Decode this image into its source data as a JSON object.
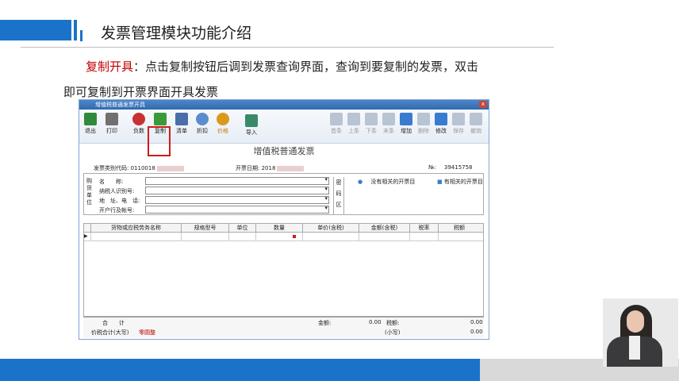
{
  "slide": {
    "title": "发票管理模块功能介绍",
    "highlight": "复制开具",
    "desc_part1": "：点击复制按钮后调到发票查询界面，查询到要复制的发票，双击",
    "desc_part2": "即可复制到开票界面开具发票"
  },
  "window": {
    "title": "增值税普通发票开具",
    "close_label": "x",
    "toolbar_left": [
      {
        "label": "退出",
        "icon": "exit-icon",
        "color": "#2f8b3a"
      },
      {
        "label": "打印",
        "icon": "printer-icon",
        "color": "#707070"
      },
      {
        "label": "负数",
        "icon": "negative-icon",
        "color": "#c93030"
      },
      {
        "label": "复制",
        "icon": "copy-icon",
        "color": "#3a9a3a"
      },
      {
        "label": "清单",
        "icon": "list-icon",
        "color": "#4a6fa8"
      },
      {
        "label": "折扣",
        "icon": "discount-icon",
        "color": "#5a8ccf"
      },
      {
        "label": "价格",
        "icon": "price-icon",
        "color": "#d99a1a"
      },
      {
        "label": "导入",
        "icon": "import-icon",
        "color": "#3a8a6a"
      }
    ],
    "toolbar_right": [
      {
        "label": "首条",
        "icon": "first-icon",
        "enabled": false
      },
      {
        "label": "上条",
        "icon": "prev-icon",
        "enabled": false
      },
      {
        "label": "下条",
        "icon": "next-icon",
        "enabled": false
      },
      {
        "label": "末条",
        "icon": "last-icon",
        "enabled": false
      },
      {
        "label": "增加",
        "icon": "add-icon",
        "enabled": true
      },
      {
        "label": "删除",
        "icon": "delete-icon",
        "enabled": false
      },
      {
        "label": "修改",
        "icon": "edit-icon",
        "enabled": true
      },
      {
        "label": "保存",
        "icon": "save-icon",
        "enabled": false
      },
      {
        "label": "撤销",
        "icon": "cancel-icon",
        "enabled": false
      }
    ],
    "form_title": "增值税普通发票",
    "invoice_code_label": "发票类别代码:",
    "invoice_code": "0110018",
    "invoice_date_label": "开票日期:",
    "invoice_date": "2018",
    "number_label": "№:",
    "number": "39415758",
    "buyer_section": "购货单位",
    "buyer_fields": [
      "名　　称:",
      "纳税人识别号:",
      "地　址、电　话:",
      "开户行及帐号:"
    ],
    "password_section": "密码区",
    "password_item1": "没有相关的开票目",
    "password_item2": "有相关的开票目",
    "columns": [
      "货物或应税劳务名称",
      "规格型号",
      "单位",
      "数量",
      "单价(含税)",
      "金额(含税)",
      "税率",
      "税额"
    ],
    "total_label": "合　　计",
    "amount_label": "金额:",
    "amount_value": "0.00",
    "tax_label": "税额:",
    "tax_value": "0.00",
    "total_words_label": "价税合计(大写)",
    "total_words_value": "零圆整",
    "small_label": "(小写)",
    "small_value": "0.00"
  },
  "colors": {
    "accent": "#1a73c8",
    "highlight": "#c00000",
    "copy_frame": "#d21a1a"
  }
}
